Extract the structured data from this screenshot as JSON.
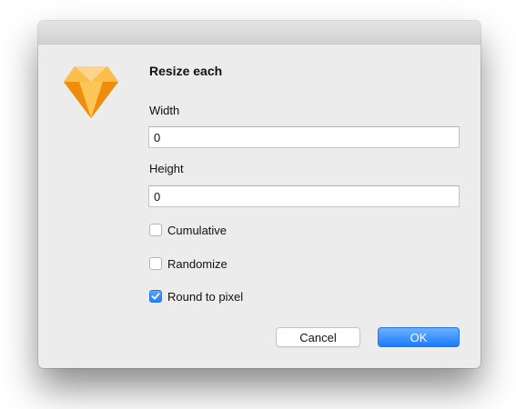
{
  "dialog": {
    "heading": "Resize each",
    "width": {
      "label": "Width",
      "value": "0"
    },
    "height": {
      "label": "Height",
      "value": "0"
    },
    "options": [
      {
        "label": "Cumulative",
        "checked": false
      },
      {
        "label": "Randomize",
        "checked": false
      },
      {
        "label": "Round to pixel",
        "checked": true
      }
    ],
    "buttons": {
      "cancel": "Cancel",
      "ok": "OK"
    }
  },
  "icons": {
    "app": "sketch-diamond-icon",
    "check": "checkmark-icon"
  },
  "colors": {
    "accent": "#1f7dff",
    "icon_orange": "#f7a21b"
  }
}
